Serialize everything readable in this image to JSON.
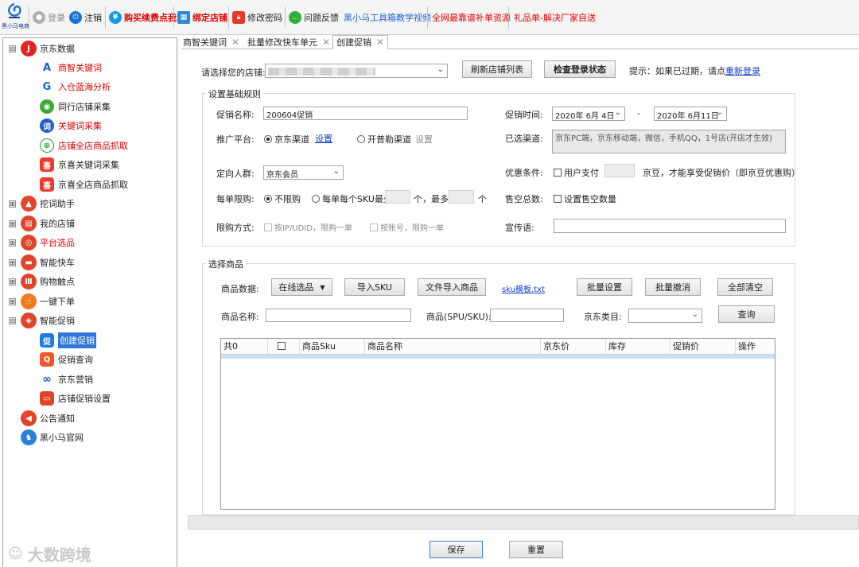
{
  "toolbar": {
    "logo_text": "黑小马电商",
    "login": "登录",
    "logout": "注销",
    "renew": "购买续费点我",
    "bind_shop": "绑定店铺",
    "change_pwd": "修改密码",
    "feedback": "问题反馈",
    "tutorial": "黑小马工具箱教学视频",
    "resources": "全网最靠谱补单资源",
    "gift": "礼品单-解决厂家自送"
  },
  "tree": {
    "jd_data": "京东数据",
    "jd_children": [
      "商智关键词",
      "入仓蓝海分析",
      "同行店铺采集",
      "关键词采集",
      "店铺全店商品抓取",
      "京喜关键词采集",
      "京喜全店商品抓取"
    ],
    "dig_words": "挖词助手",
    "my_shop": "我的店铺",
    "platform_pick": "平台选品",
    "smart_express": "智能快车",
    "shopping_touch": "购物触点",
    "one_click_order": "一键下单",
    "smart_promo": "智能促销",
    "promo_children": [
      "创建促销",
      "促销查询",
      "京东营销",
      "店铺促销设置"
    ],
    "notice": "公告通知",
    "official_site": "黑小马官网",
    "expand": "⊞",
    "collapse": "⊟"
  },
  "watermark": "大数跨境",
  "tabs": [
    "商智关键词",
    "批量修改快车单元",
    "创建促销"
  ],
  "form": {
    "shop_label": "请选择您的店铺:",
    "refresh_btn": "刷新店铺列表",
    "check_login_btn": "检查登录状态",
    "hint": "提示：如果已过期，请点",
    "relogin_link": "重新登录",
    "basic_group": "设置基础规则",
    "promo_name_label": "促销名称:",
    "promo_name_value": "200604促销",
    "promo_time_label": "促销时间:",
    "date_start": "2020年 6月 4日",
    "date_sep": "-",
    "date_end": "2020年 6月11日",
    "platform_label": "推广平台:",
    "jd_channel": "京东渠道",
    "settings_link": "设置",
    "kpl_channel": "开普勒渠道",
    "settings_text": "设置",
    "selected_channel_label": "已选渠道:",
    "selected_channel_value": "京东PC端，京东移动端，微信，手机QQ，1号店(开店才生效)",
    "target_label": "定向人群:",
    "target_value": "京东会员",
    "discount_label": "优惠条件:",
    "user_pay": "用户支付",
    "jd_bean_text": "京豆，才能享受促销价（即京豆优惠购）",
    "limit_label": "每单限购:",
    "no_limit": "不限购",
    "per_sku": "每单每个SKU最少",
    "unit1": "个，最多",
    "unit2": "个",
    "sold_out_label": "售空总数:",
    "set_sold_out": "设置售空数量",
    "limit_mode_label": "限购方式:",
    "by_ip": "按IP/UDID，限购一单",
    "by_account": "按账号，限购一单",
    "slogan_label": "宣传语:",
    "product_group": "选择商品",
    "product_data_label": "商品数据:",
    "online_pick": "在线选品",
    "import_sku": "导入SKU",
    "file_import": "文件导入商品",
    "sku_template": "sku模板.txt",
    "batch_set": "批量设置",
    "batch_cancel": "批量撤消",
    "clear_all": "全部清空",
    "product_name_label": "商品名称:",
    "spu_label": "商品(SPU/SKU):",
    "jd_category_label": "京东类目:",
    "query_btn": "查询"
  },
  "grid": {
    "headers": [
      "共0",
      "",
      "商品Sku",
      "商品名称",
      "京东价",
      "库存",
      "促销价",
      "操作"
    ]
  },
  "footer": {
    "save": "保存",
    "reset": "重置"
  }
}
